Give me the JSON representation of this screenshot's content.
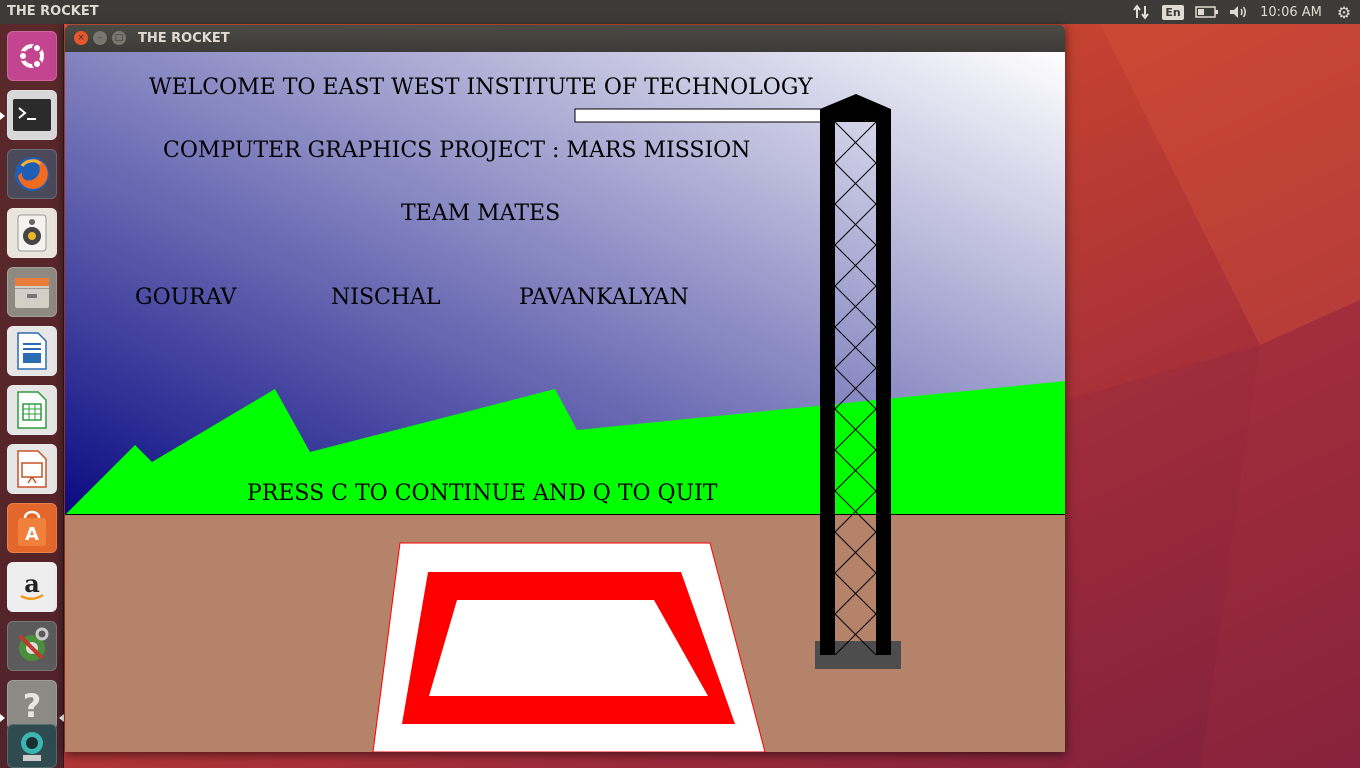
{
  "top_panel": {
    "title": "THE ROCKET",
    "keyboard_layout": "En",
    "clock": "10:06 AM",
    "icons": [
      "network-icon",
      "keyboard-icon",
      "battery-icon",
      "volume-icon",
      "settings-gear-icon"
    ]
  },
  "launcher": {
    "items": [
      {
        "name": "ubuntu-dash",
        "color": "#c3458f"
      },
      {
        "name": "terminal",
        "color": "#4a4a4a"
      },
      {
        "name": "firefox",
        "color": "#e8742c"
      },
      {
        "name": "rhythmbox",
        "color": "#e9e5dd"
      },
      {
        "name": "files",
        "color": "#b9b2a6"
      },
      {
        "name": "libreoffice-writer",
        "color": "#f2f2f2"
      },
      {
        "name": "libreoffice-calc",
        "color": "#f2f2f2"
      },
      {
        "name": "libreoffice-impress",
        "color": "#f2f2f2"
      },
      {
        "name": "ubuntu-software",
        "color": "#e3662b"
      },
      {
        "name": "amazon",
        "color": "#f2f2f2"
      },
      {
        "name": "system-settings",
        "color": "#5b5b5b"
      },
      {
        "name": "help",
        "color": "#8c8a85"
      },
      {
        "name": "the-rocket-app",
        "color": "#3a6e73"
      }
    ]
  },
  "window": {
    "title": "THE ROCKET",
    "buttons": {
      "close": "×",
      "minimize": "–",
      "maximize": "□"
    }
  },
  "scene": {
    "line1": "WELCOME TO EAST WEST INSTITUTE OF TECHNOLOGY",
    "line2": "COMPUTER GRAPHICS PROJECT : MARS MISSION",
    "line3": "TEAM MATES",
    "members": [
      "GOURAV",
      "NISCHAL",
      "PAVANKALYAN"
    ],
    "prompt": "PRESS C TO CONTINUE AND Q TO QUIT",
    "colors": {
      "sky_dark": "#0a0a82",
      "sky_light": "#ffffff",
      "hills": "#00ff00",
      "ground": "#b5826a",
      "pad_outer": "#ffffff",
      "pad_ring": "#ff0000",
      "tower": "#000000",
      "tower_base": "#4d4d4d"
    }
  }
}
